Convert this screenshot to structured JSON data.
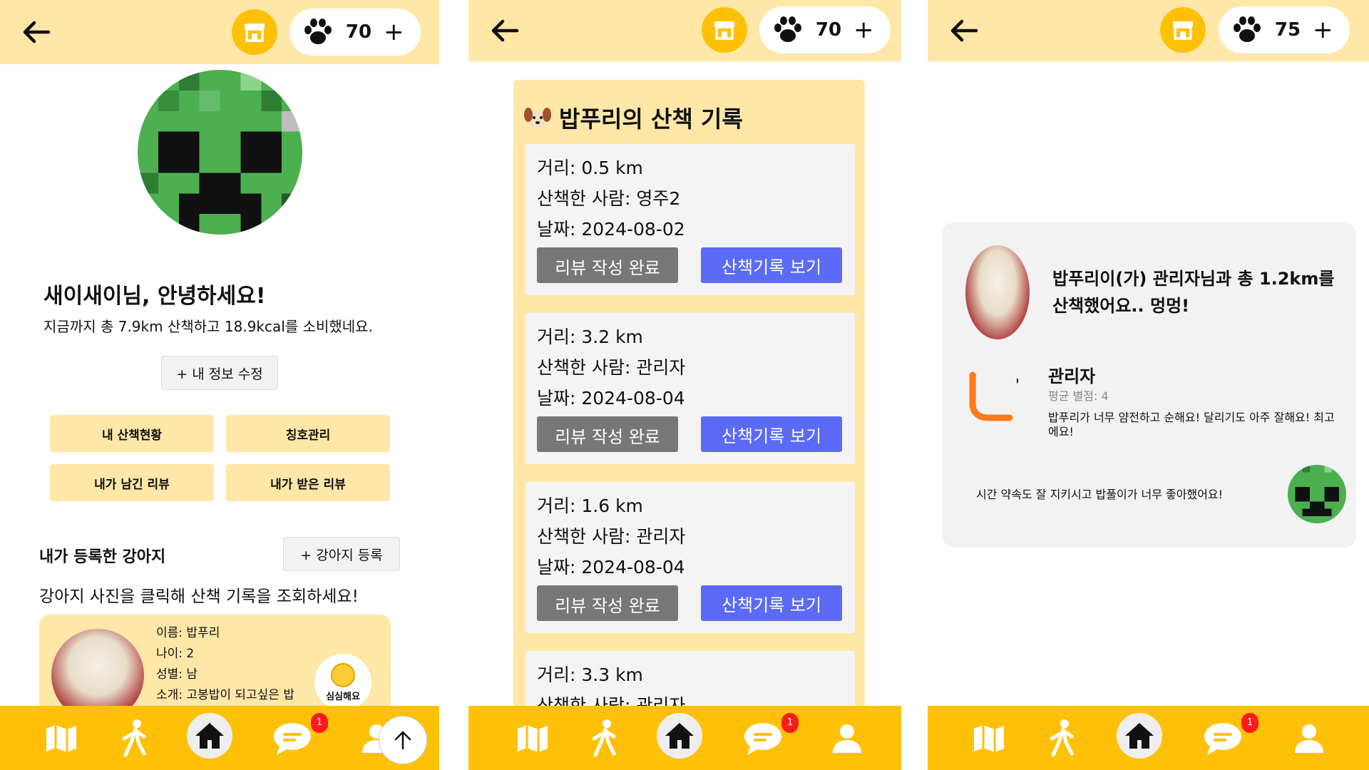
{
  "colors": {
    "header": "#FFE7A8",
    "accent": "#FFC107",
    "primary_button": "#5B6BF7",
    "review_done_button": "#777777",
    "badge": "#FF1A1A"
  },
  "nav_icons": [
    "map-icon",
    "walk-icon",
    "home-icon",
    "chat-icon",
    "profile-icon"
  ],
  "panel1": {
    "points": "70",
    "greeting": "새이새이님, 안녕하세요!",
    "summary": "지금까지 총 7.9km 산책하고 18.9kcal를 소비했네요.",
    "edit_profile": "+ 내 정보 수정",
    "menu": [
      "내 산책현황",
      "칭호관리",
      "내가 남긴 리뷰",
      "내가 받은 리뷰"
    ],
    "dogs_title": "내가 등록한 강아지",
    "dog_register": "+ 강아지 등록",
    "dogs_hint": "강아지 사진을 클릭해 산책 기록을 조회하세요!",
    "dog": {
      "name": "이름: 밥푸리",
      "age": "나이: 2",
      "gender": "성별: 남",
      "intro": "소개: 고봉밥이 되고싶은 밥",
      "mood": "심심해요"
    },
    "chat_badge": "1"
  },
  "panel2": {
    "points": "70",
    "title": "밥푸리의 산책 기록",
    "review_done_label": "리뷰 작성 완료",
    "view_label": "산책기록 보기",
    "records": [
      {
        "distance": "거리: 0.5 km",
        "walker": "산책한 사람: 영주2",
        "date": "날짜: 2024-08-02"
      },
      {
        "distance": "거리: 3.2 km",
        "walker": "산책한 사람: 관리자",
        "date": "날짜: 2024-08-04"
      },
      {
        "distance": "거리: 1.6 km",
        "walker": "산책한 사람: 관리자",
        "date": "날짜: 2024-08-04"
      },
      {
        "distance": "거리: 3.3 km",
        "walker": "산책한 사람: 관리자",
        "date": ""
      }
    ],
    "chat_badge": "1"
  },
  "panel3": {
    "points": "75",
    "headline": "밥푸리이(가) 관리자님과 총 1.2km를 산책했어요.. 멍멍!",
    "reviewer": "관리자",
    "score": "평균 별점: 4",
    "review": "밥푸리가 너무 얌전하고 순해요! 달리기도 아주 잘해요! 최고에요!",
    "comment": "시간 약속도 잘 지키시고 밥풀이가 너무 좋아했어요!",
    "chat_badge": "1"
  }
}
